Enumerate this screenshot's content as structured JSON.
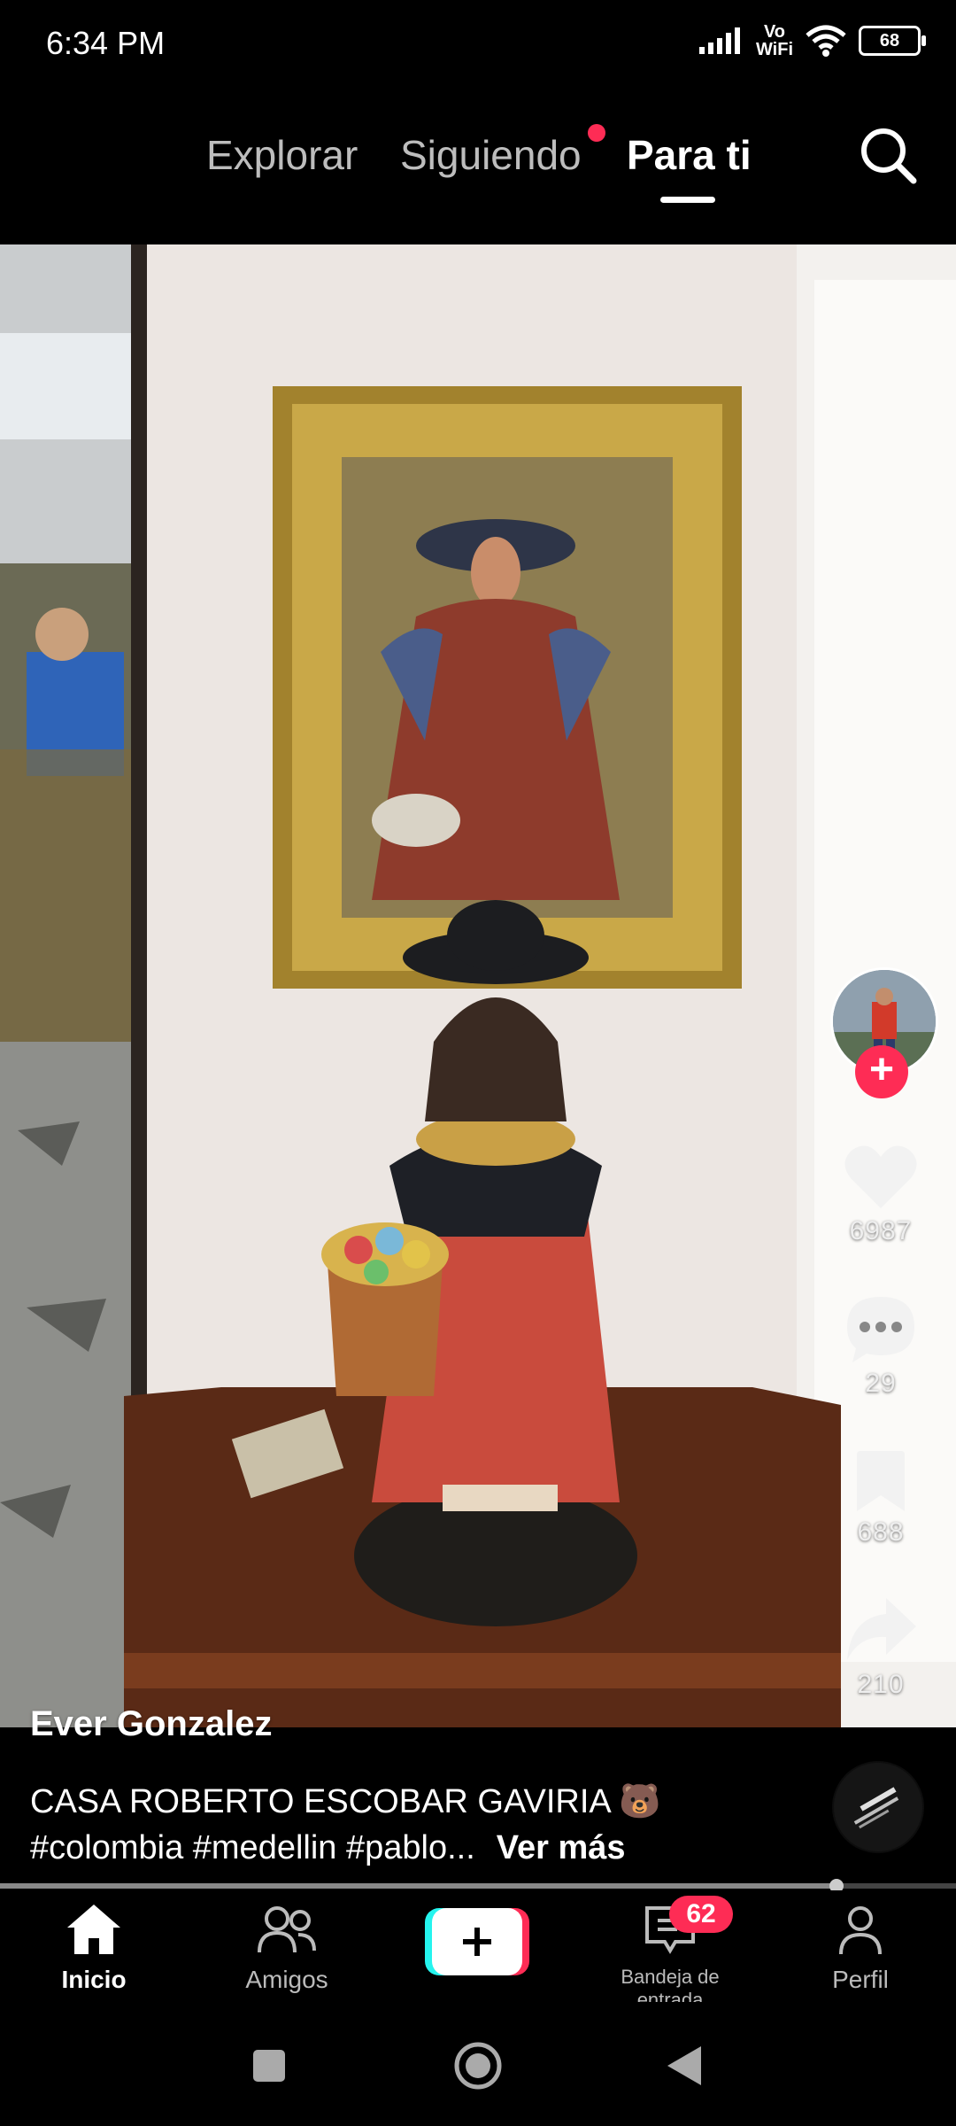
{
  "status": {
    "time": "6:34 PM",
    "vowifi_top": "Vo",
    "vowifi_bottom": "WiFi",
    "battery": "68"
  },
  "topnav": {
    "tabs": [
      {
        "label": "Explorar"
      },
      {
        "label": "Siguiendo"
      },
      {
        "label": "Para ti"
      }
    ],
    "active_tab": "Para ti"
  },
  "post": {
    "author": "Ever Gonzalez",
    "caption_line1": "CASA ROBERTO ESCOBAR GAVIRIA 🐻",
    "caption_line2": "#colombia #medellin #pablo...",
    "see_more": "Ver más",
    "likes": "6987",
    "comments": "29",
    "saves": "688",
    "shares": "210",
    "progress": 0.875
  },
  "bottomnav": {
    "items": [
      {
        "label": "Inicio"
      },
      {
        "label": "Amigos"
      },
      {
        "label": ""
      },
      {
        "label": "Bandeja de entrada"
      },
      {
        "label": "Perfil"
      }
    ],
    "inbox_badge": "62"
  },
  "colors": {
    "accent": "#fe2c55",
    "cyan": "#25f4ee",
    "background": "#000000"
  }
}
